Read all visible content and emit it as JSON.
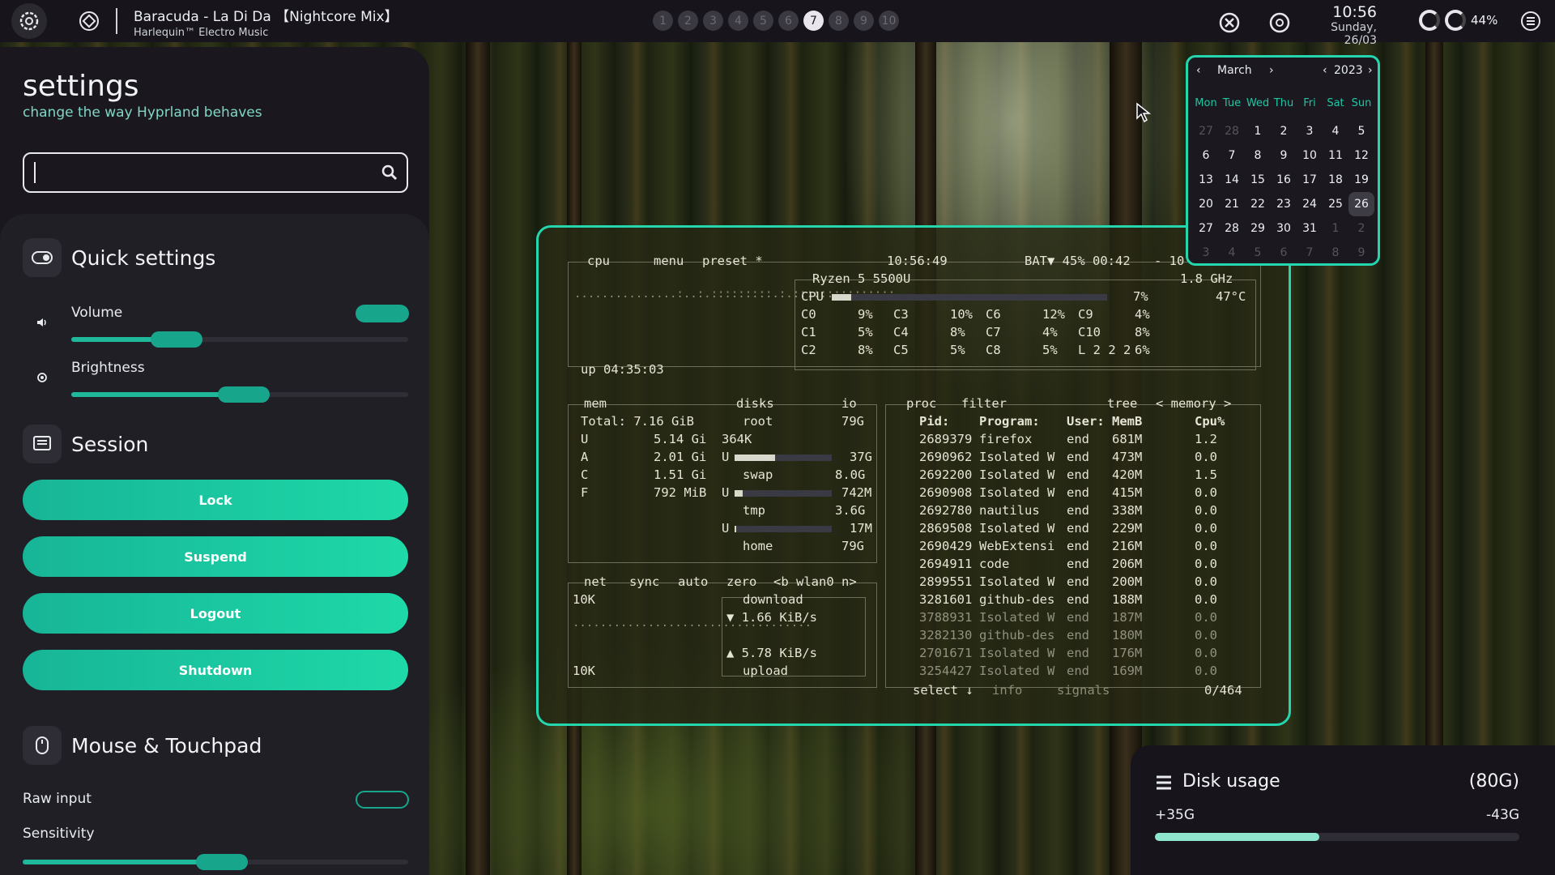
{
  "topbar": {
    "media_title": "Baracuda - La Di Da 【Nightcore Mix】",
    "media_artist": "Harlequin™ Electro Music",
    "workspaces": [
      "1",
      "2",
      "3",
      "4",
      "5",
      "6",
      "7",
      "8",
      "9",
      "10"
    ],
    "active_workspace": "7",
    "clock_time": "10:56",
    "clock_date": "Sunday, 26/03",
    "battery_percent": "44%"
  },
  "settings": {
    "title": "settings",
    "subtitle": "change the way Hyprland behaves",
    "search": {
      "value": "",
      "placeholder": ""
    },
    "quick": {
      "title": "Quick settings",
      "volume_label": "Volume",
      "volume_level": 0.35,
      "volume_toggle": true,
      "brightness_label": "Brightness",
      "brightness_level": 0.55
    },
    "session": {
      "title": "Session",
      "lock": "Lock",
      "suspend": "Suspend",
      "logout": "Logout",
      "shutdown": "Shutdown"
    },
    "mouse": {
      "title": "Mouse & Touchpad",
      "raw_input_label": "Raw input",
      "raw_input": false,
      "sensitivity_label": "Sensitivity",
      "sensitivity_level": 0.55
    }
  },
  "btop": {
    "cpu_tab": "cpu",
    "menu": "menu",
    "preset": "preset *",
    "time": "10:56:49",
    "battery": "BAT▼ 45% 00:42",
    "minus": "- 10",
    "cpu_model": "Ryzen 5 5500U",
    "freq": "1.8 GHz",
    "cpu_total_label": "CPU",
    "cpu_total_pct": "7%",
    "cpu_temp": "47°C",
    "cpu_total_level": 0.07,
    "cores": [
      [
        "C0",
        "9%"
      ],
      [
        "C3",
        "10%"
      ],
      [
        "C6",
        "12%"
      ],
      [
        "C9",
        "4%"
      ],
      [
        "C1",
        "5%"
      ],
      [
        "C4",
        "8%"
      ],
      [
        "C7",
        "4%"
      ],
      [
        "C10",
        "8%"
      ],
      [
        "C2",
        "8%"
      ],
      [
        "C5",
        "5%"
      ],
      [
        "C8",
        "5%"
      ],
      [
        "L",
        "2 2 2",
        "6%"
      ]
    ],
    "uptime": "up 04:35:03",
    "mem_tab": "mem",
    "disks_tab": "disks",
    "io_tab": "io",
    "mem_total": "Total: 7.16 GiB",
    "mem_rows": [
      [
        "U",
        "5.14 Gi"
      ],
      [
        "A",
        "2.01 Gi"
      ],
      [
        "C",
        "1.51 Gi"
      ],
      [
        "F",
        "792 MiB"
      ]
    ],
    "disk_rows": {
      "root": "root",
      "root_size": "79G",
      "io": "364K",
      "u_root": "37G",
      "swap": "swap",
      "swap_size": "8.0G",
      "u_swap": "742M",
      "tmp": "tmp",
      "tmp_size": "3.6G",
      "u_tmp": "17M",
      "home": "home",
      "home_size": "79G"
    },
    "net_tab": "net",
    "net_sync": "sync",
    "net_auto": "auto",
    "net_zero": "zero",
    "net_iface": "<b wlan0 n>",
    "net_top": "10K",
    "net_bottom": "10K",
    "download_label": "download",
    "download_rate": "▼ 1.66 KiB/s",
    "upload_rate": "▲ 5.78 KiB/s",
    "upload_label": "upload",
    "proc_tab": "proc",
    "filter": "filter",
    "tree": "tree",
    "memory_sort": "< memory >",
    "proc_headers": [
      "Pid:",
      "Program:",
      "User:",
      "MemB",
      "Cpu%"
    ],
    "processes": [
      [
        "2689379",
        "firefox",
        "end",
        "681M",
        "1.2"
      ],
      [
        "2690962",
        "Isolated W",
        "end",
        "473M",
        "0.0"
      ],
      [
        "2692200",
        "Isolated W",
        "end",
        "420M",
        "1.5"
      ],
      [
        "2690908",
        "Isolated W",
        "end",
        "415M",
        "0.0"
      ],
      [
        "2692780",
        "nautilus",
        "end",
        "338M",
        "0.0"
      ],
      [
        "2869508",
        "Isolated W",
        "end",
        "229M",
        "0.0"
      ],
      [
        "2690429",
        "WebExtensi",
        "end",
        "216M",
        "0.0"
      ],
      [
        "2694911",
        "code",
        "end",
        "206M",
        "0.0"
      ],
      [
        "2899551",
        "Isolated W",
        "end",
        "200M",
        "0.0"
      ],
      [
        "3281601",
        "github-des",
        "end",
        "188M",
        "0.0"
      ],
      [
        "3788931",
        "Isolated W",
        "end",
        "187M",
        "0.0"
      ],
      [
        "3282130",
        "github-des",
        "end",
        "180M",
        "0.0"
      ],
      [
        "2701671",
        "Isolated W",
        "end",
        "176M",
        "0.0"
      ],
      [
        "3254427",
        "Isolated W",
        "end",
        "169M",
        "0.0"
      ]
    ],
    "select": "select ↓",
    "info": "info",
    "signals": "signals",
    "proc_count": "0/464"
  },
  "calendar": {
    "month": "March",
    "year": "2023",
    "weekdays": [
      "Mon",
      "Tue",
      "Wed",
      "Thu",
      "Fri",
      "Sat",
      "Sun"
    ],
    "days": [
      [
        "27",
        "m"
      ],
      [
        "28",
        "m"
      ],
      [
        "1",
        ""
      ],
      [
        "2",
        ""
      ],
      [
        "3",
        ""
      ],
      [
        "4",
        ""
      ],
      [
        "5",
        ""
      ],
      [
        "6",
        ""
      ],
      [
        "7",
        ""
      ],
      [
        "8",
        ""
      ],
      [
        "9",
        ""
      ],
      [
        "10",
        ""
      ],
      [
        "11",
        ""
      ],
      [
        "12",
        ""
      ],
      [
        "13",
        ""
      ],
      [
        "14",
        ""
      ],
      [
        "15",
        ""
      ],
      [
        "16",
        ""
      ],
      [
        "17",
        ""
      ],
      [
        "18",
        ""
      ],
      [
        "19",
        ""
      ],
      [
        "20",
        ""
      ],
      [
        "21",
        ""
      ],
      [
        "22",
        ""
      ],
      [
        "23",
        ""
      ],
      [
        "24",
        ""
      ],
      [
        "25",
        ""
      ],
      [
        "26",
        "t"
      ],
      [
        "27",
        ""
      ],
      [
        "28",
        ""
      ],
      [
        "29",
        ""
      ],
      [
        "30",
        ""
      ],
      [
        "31",
        ""
      ],
      [
        "1",
        "m"
      ],
      [
        "2",
        "m"
      ],
      [
        "3",
        "m"
      ],
      [
        "4",
        "m"
      ],
      [
        "5",
        "m"
      ],
      [
        "6",
        "m"
      ],
      [
        "7",
        "m"
      ],
      [
        "8",
        "m"
      ],
      [
        "9",
        "m"
      ]
    ]
  },
  "disk": {
    "title": "Disk usage",
    "total": "(80G)",
    "used": "+35G",
    "free": "-43G",
    "used_level": 0.45
  },
  "colors": {
    "accent": "#23d6ad",
    "panel": "#1a181e",
    "button": "#1ed9a8"
  }
}
